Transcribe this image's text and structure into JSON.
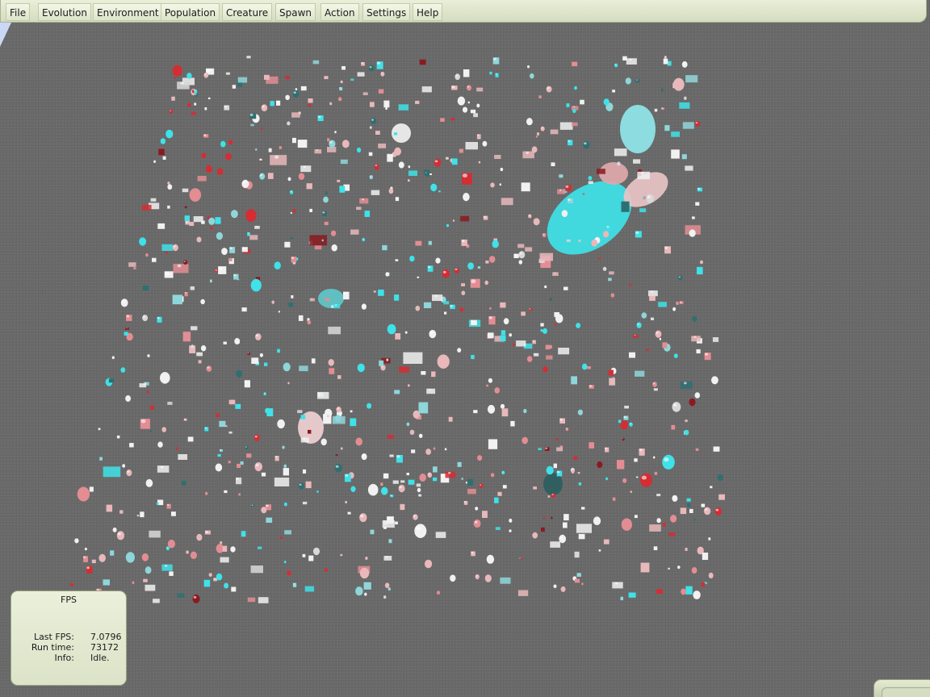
{
  "menu": {
    "items": [
      {
        "id": "file",
        "label": "File"
      },
      {
        "id": "evolution",
        "label": "Evolution"
      },
      {
        "id": "environment",
        "label": "Environment"
      },
      {
        "id": "population",
        "label": "Population"
      },
      {
        "id": "creature",
        "label": "Creature"
      },
      {
        "id": "spawn",
        "label": "Spawn"
      },
      {
        "id": "action",
        "label": "Action"
      },
      {
        "id": "settings",
        "label": "Settings"
      },
      {
        "id": "help",
        "label": "Help"
      }
    ]
  },
  "fps_panel": {
    "title": "FPS",
    "rows": [
      {
        "label": "Last FPS:",
        "value": "7.0796"
      },
      {
        "label": "Run time:",
        "value": "73172"
      },
      {
        "label": "Info:",
        "value": "Idle."
      }
    ]
  },
  "colors": {
    "floor": "#6a6a6a",
    "panel": "#e2e9d2",
    "cyan": "#33e6ec",
    "pink": "#e9a1a6",
    "red": "#d42a30",
    "white": "#f0f0f0"
  }
}
